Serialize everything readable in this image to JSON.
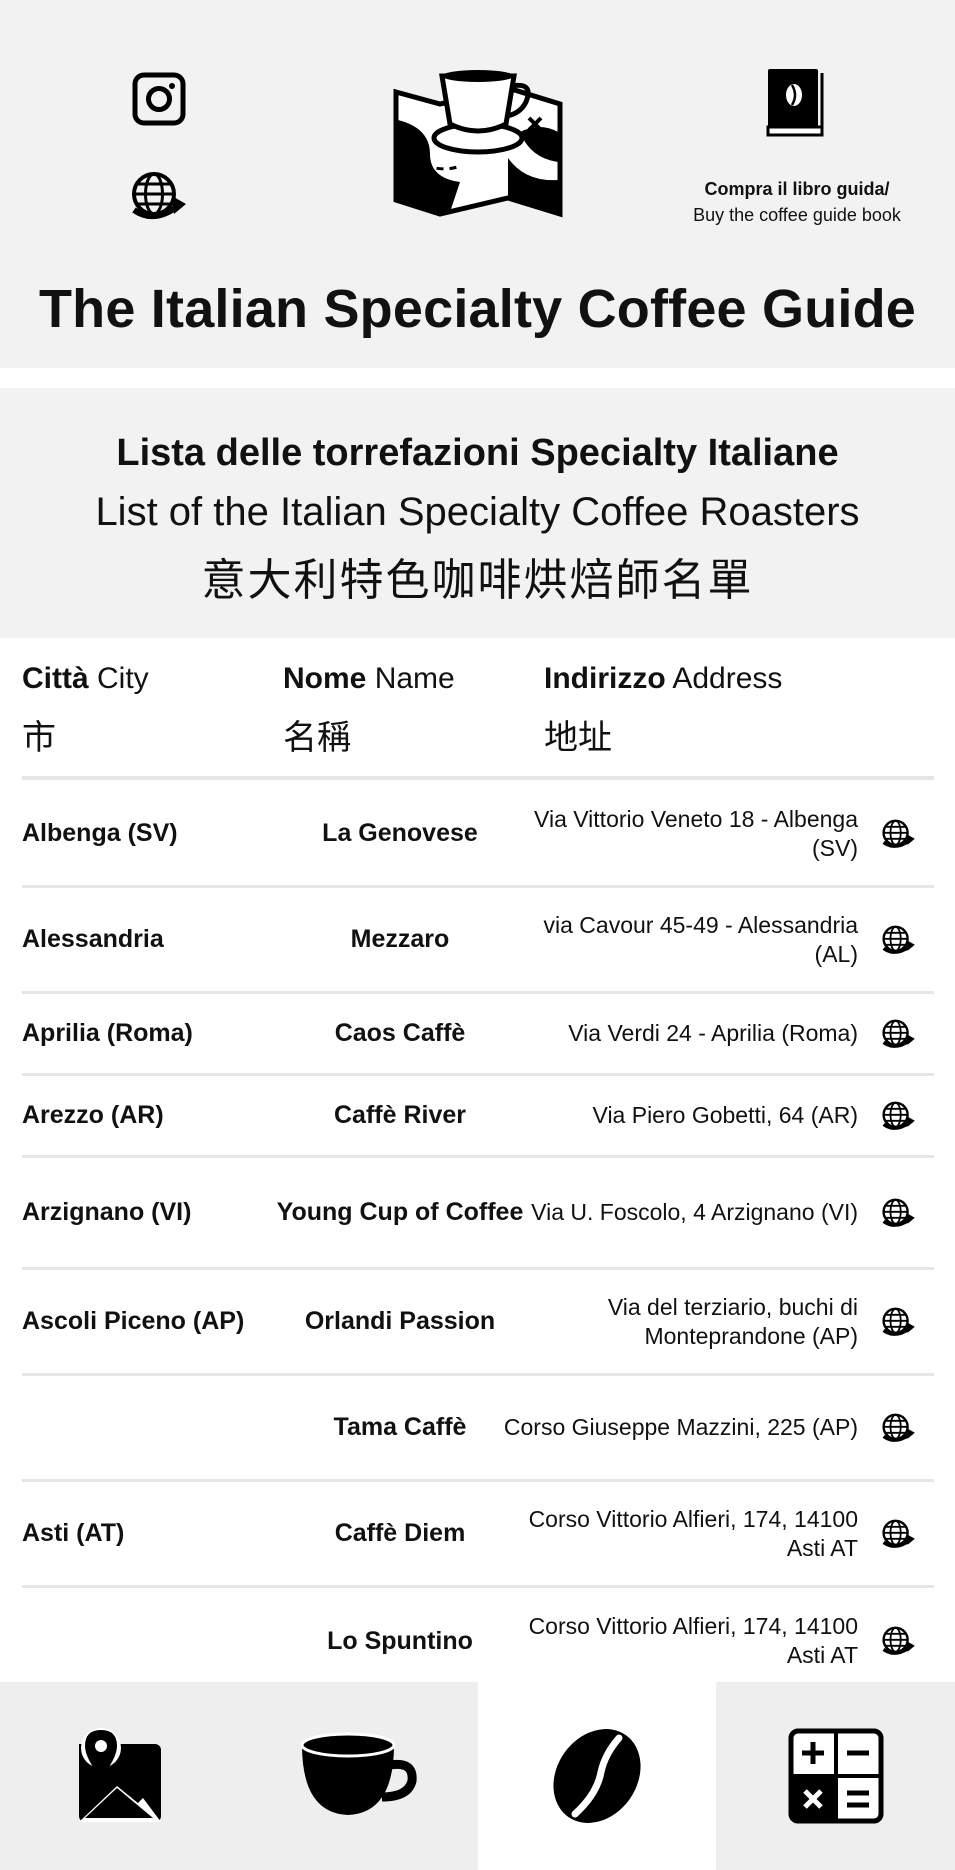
{
  "header": {
    "title": "The Italian Specialty Coffee Guide",
    "book_line1": "Compra il libro guida/",
    "book_line2": "Buy the coffee guide book"
  },
  "section": {
    "title_it": "Lista delle torrefazioni Specialty Italiane",
    "title_en": "List of the Italian Specialty Coffee Roasters",
    "title_zh": "意大利特色咖啡烘焙師名單"
  },
  "table": {
    "headers": [
      {
        "bold": "Città",
        "normal": "City",
        "zh": "市"
      },
      {
        "bold": "Nome",
        "normal": "Name",
        "zh": "名稱"
      },
      {
        "bold": "Indirizzo",
        "normal": "Address",
        "zh": "地址"
      }
    ],
    "rows": [
      {
        "city": "Albenga (SV)",
        "name": "La Genovese",
        "address": "Via Vittorio Veneto 18 - Albenga (SV)"
      },
      {
        "city": "Alessandria",
        "name": "Mezzaro",
        "address": "via Cavour 45-49 - Alessandria (AL)"
      },
      {
        "city": "Aprilia (Roma)",
        "name": "Caos Caffè",
        "address": "Via Verdi 24 - Aprilia (Roma)"
      },
      {
        "city": "Arezzo (AR)",
        "name": "Caffè River",
        "address": "Via Piero Gobetti, 64 (AR)"
      },
      {
        "city": "Arzignano (VI)",
        "name": "Young Cup of Coffee",
        "address": "Via U. Foscolo, 4 Arzignano (VI)"
      },
      {
        "city": "Ascoli Piceno (AP)",
        "name": "Orlandi Passion",
        "address": "Via del terziario, buchi di Monteprandone  (AP)"
      },
      {
        "city": "",
        "name": "Tama Caffè",
        "address": "Corso Giuseppe Mazzini, 225 (AP)"
      },
      {
        "city": "Asti (AT)",
        "name": "Caffè Diem",
        "address": "Corso Vittorio Alfieri, 174, 14100 Asti AT"
      },
      {
        "city": "",
        "name": "Lo Spuntino",
        "address": "Corso Vittorio Alfieri, 174, 14100 Asti AT"
      }
    ]
  },
  "nav": [
    {
      "icon": "map-icon",
      "active": false
    },
    {
      "icon": "coffee-cup-icon",
      "active": false
    },
    {
      "icon": "coffee-bean-icon",
      "active": true
    },
    {
      "icon": "calculator-icon",
      "active": false
    }
  ]
}
